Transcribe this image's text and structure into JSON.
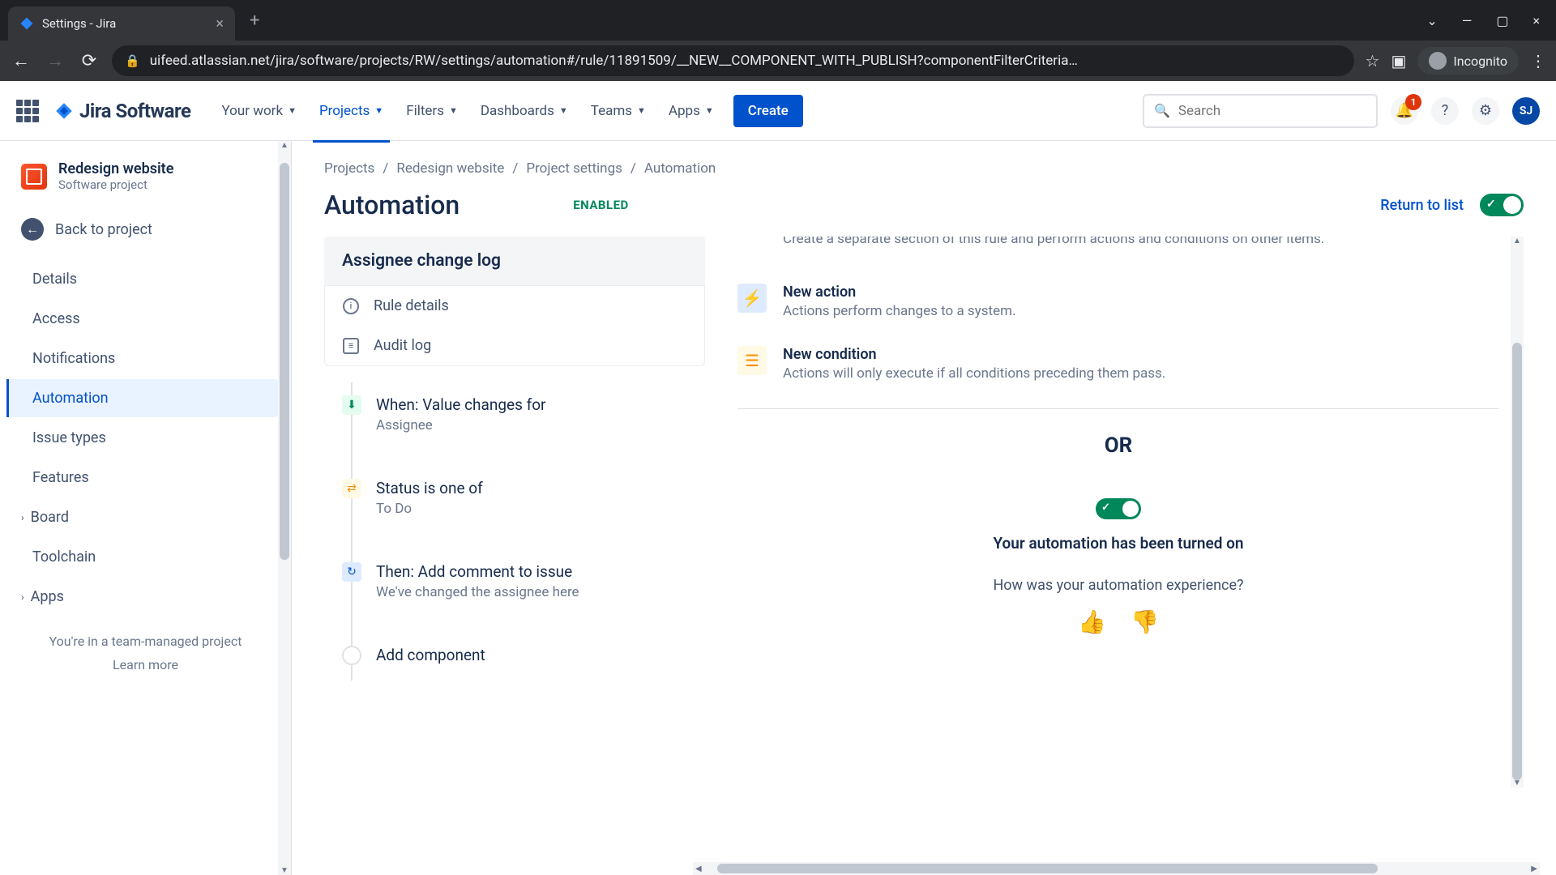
{
  "browser": {
    "tab_title": "Settings - Jira",
    "url": "uifeed.atlassian.net/jira/software/projects/RW/settings/automation#/rule/11891509/__NEW__COMPONENT_WITH_PUBLISH?componentFilterCriteria…",
    "incognito": "Incognito"
  },
  "header": {
    "logo": "Jira Software",
    "nav": {
      "your_work": "Your work",
      "projects": "Projects",
      "filters": "Filters",
      "dashboards": "Dashboards",
      "teams": "Teams",
      "apps": "Apps"
    },
    "create": "Create",
    "search_placeholder": "Search",
    "notification_count": "1",
    "avatar": "SJ"
  },
  "sidebar": {
    "project_name": "Redesign website",
    "project_type": "Software project",
    "back": "Back to project",
    "items": {
      "details": "Details",
      "access": "Access",
      "notifications": "Notifications",
      "automation": "Automation",
      "issue_types": "Issue types",
      "features": "Features",
      "board": "Board",
      "toolchain": "Toolchain",
      "apps": "Apps"
    },
    "footer_text": "You're in a team-managed project",
    "footer_link": "Learn more"
  },
  "breadcrumb": {
    "projects": "Projects",
    "project": "Redesign website",
    "settings": "Project settings",
    "automation": "Automation"
  },
  "page": {
    "title": "Automation",
    "enabled": "ENABLED",
    "return": "Return to list"
  },
  "rule": {
    "name": "Assignee change log",
    "details": "Rule details",
    "audit": "Audit log",
    "steps": {
      "trigger_title": "When: Value changes for",
      "trigger_sub": "Assignee",
      "cond_title": "Status is one of",
      "cond_sub": "To Do",
      "action_title": "Then: Add comment to issue",
      "action_sub": "We've changed the assignee here",
      "add": "Add component"
    }
  },
  "detail": {
    "branch_desc": "Create a separate section of this rule and perform actions and conditions on other items.",
    "action_title": "New action",
    "action_desc": "Actions perform changes to a system.",
    "cond_title": "New condition",
    "cond_desc": "Actions will only execute if all conditions preceding them pass.",
    "or": "OR",
    "on_text": "Your automation has been turned on",
    "feedback": "How was your automation experience?"
  }
}
